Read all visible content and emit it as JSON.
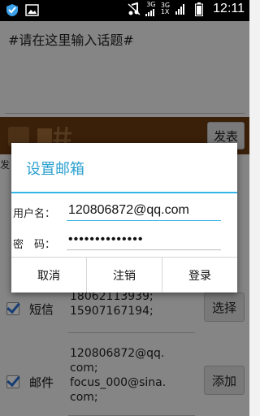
{
  "status_bar": {
    "net_top": "3G",
    "net_bottom": "3G",
    "net_bottom2": "1X",
    "time": "12:11",
    "icons": [
      "shield-icon",
      "image-icon",
      "music-mute-icon",
      "signal-icon",
      "battery-icon"
    ]
  },
  "app": {
    "topic_placeholder": "#请在这里输入话题#",
    "publish_label": "发表",
    "send_label": "发",
    "rows": [
      {
        "label": "短信",
        "value": "13391168750;\n18062113939;\n15907167194;",
        "button": "选择"
      },
      {
        "label": "邮件",
        "value": "120806872@qq.\ncom;\nfocus_000@sina.\ncom;",
        "button": "添加"
      }
    ]
  },
  "dialog": {
    "title": "设置邮箱",
    "username_label": "用户名：",
    "username_value": "120806872@qq.com",
    "password_label": "密　码：",
    "password_value": "••••••••••••••",
    "buttons": {
      "cancel": "取消",
      "logout": "注销",
      "login": "登录"
    }
  },
  "colors": {
    "accent": "#33b5e5",
    "title": "#2ba0cf",
    "toolbar": "#6b3a12"
  }
}
